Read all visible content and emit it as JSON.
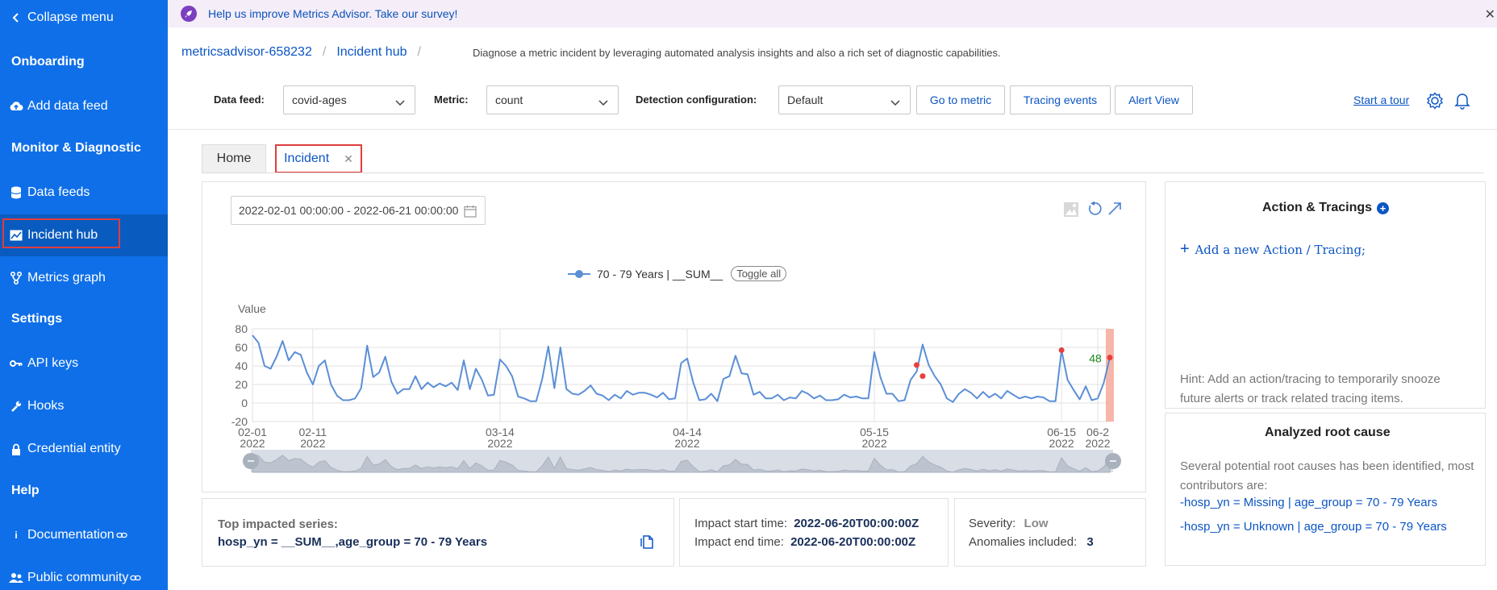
{
  "sidebar": {
    "collapse_label": "Collapse menu",
    "sections": {
      "onboarding": "Onboarding",
      "monitor": "Monitor & Diagnostic",
      "settings": "Settings",
      "help": "Help"
    },
    "items": {
      "add_data_feed": "Add data feed",
      "data_feeds": "Data feeds",
      "incident_hub": "Incident hub",
      "metrics_graph": "Metrics graph",
      "api_keys": "API keys",
      "hooks": "Hooks",
      "credential_entity": "Credential entity",
      "documentation": "Documentation",
      "public_community": "Public community"
    },
    "accent": "#0f6fe8",
    "active_bg": "#0a5bbf"
  },
  "banner": {
    "text": "Help us improve Metrics Advisor. Take our survey!"
  },
  "breadcrumb": {
    "resource": "metricsadvisor-658232",
    "page": "Incident hub",
    "description": "Diagnose a metric incident by leveraging automated analysis insights and also a rich set of diagnostic capabilities."
  },
  "toolbar": {
    "data_feed_label": "Data feed:",
    "data_feed_value": "covid-ages",
    "metric_label": "Metric:",
    "metric_value": "count",
    "detection_label": "Detection configuration:",
    "detection_value": "Default",
    "go_to_metric": "Go to metric",
    "tracing_events": "Tracing events",
    "alert_view": "Alert View",
    "start_tour": "Start a tour"
  },
  "tabs": {
    "home": "Home",
    "incident": "Incident"
  },
  "chart_panel": {
    "date_range": "2022-02-01 00:00:00 - 2022-06-21 00:00:00",
    "legend_series": "70 - 79 Years | __SUM__",
    "toggle_all": "Toggle all"
  },
  "chart_data": {
    "type": "line",
    "ylabel": "Value",
    "ylim": [
      -20,
      80
    ],
    "y_ticks": [
      "80",
      "60",
      "40",
      "20",
      "0",
      "-20"
    ],
    "x_ticks": [
      {
        "date": "02-01",
        "year": "2022",
        "day": 0
      },
      {
        "date": "02-11",
        "year": "2022",
        "day": 10
      },
      {
        "date": "03-14",
        "year": "2022",
        "day": 41
      },
      {
        "date": "04-14",
        "year": "2022",
        "day": 72
      },
      {
        "date": "05-15",
        "year": "2022",
        "day": 103
      },
      {
        "date": "06-15",
        "year": "2022",
        "day": 134
      },
      {
        "date": "06-2",
        "year": "2022",
        "day": 140
      }
    ],
    "series": [
      {
        "name": "70 - 79 Years | __SUM__",
        "color": "#5b8fd6",
        "values": [
          73,
          65,
          40,
          37,
          50,
          67,
          46,
          55,
          52,
          33,
          20,
          40,
          46,
          20,
          8,
          3,
          3,
          5,
          16,
          62,
          28,
          33,
          50,
          23,
          10,
          15,
          15,
          29,
          15,
          22,
          17,
          21,
          18,
          22,
          14,
          46,
          15,
          37,
          25,
          8,
          9,
          47,
          40,
          29,
          7,
          5,
          2,
          2,
          26,
          61,
          16,
          60,
          15,
          10,
          9,
          13,
          19,
          10,
          8,
          3,
          9,
          5,
          13,
          9,
          11,
          11,
          9,
          6,
          11,
          4,
          5,
          43,
          48,
          22,
          3,
          4,
          10,
          2,
          26,
          29,
          51,
          32,
          31,
          9,
          12,
          5,
          5,
          9,
          3,
          6,
          5,
          13,
          10,
          5,
          8,
          3,
          3,
          4,
          9,
          6,
          7,
          5,
          5,
          55,
          28,
          10,
          10,
          2,
          3,
          25,
          34,
          63,
          41,
          29,
          20,
          5,
          1,
          10,
          15,
          11,
          5,
          12,
          6,
          10,
          5,
          13,
          9,
          5,
          7,
          5,
          7,
          6,
          2,
          2,
          57,
          25,
          14,
          4,
          18,
          3,
          5,
          22,
          49
        ],
        "anomalies": [
          {
            "day": 110,
            "value": 41
          },
          {
            "day": 111,
            "value": 29
          },
          {
            "day": 134,
            "value": 57
          },
          {
            "day": 142,
            "value": 49
          }
        ],
        "anomaly_label": "48",
        "anomaly_color": "#e84040"
      }
    ]
  },
  "info_cards": {
    "top_impacted_label": "Top impacted series:",
    "top_impacted_value": "hosp_yn = __SUM__,age_group = 70 - 79 Years",
    "impact_start_label": "Impact start time:",
    "impact_start_value": "2022-06-20T00:00:00Z",
    "impact_end_label": "Impact end time:",
    "impact_end_value": "2022-06-20T00:00:00Z",
    "severity_label": "Severity:",
    "severity_value": "Low",
    "anomalies_label": "Anomalies included:",
    "anomalies_value": "3"
  },
  "actions": {
    "title": "Action & Tracings",
    "add_link": "Add a new Action / Tracing;",
    "hint": "Hint: Add an action/tracing to temporarily snooze future alerts or track related tracing items."
  },
  "root_cause": {
    "title": "Analyzed root cause",
    "intro": "Several potential root causes has been identified, most contributors are:",
    "items": [
      "-hosp_yn = Missing | age_group = 70 - 79 Years",
      "-hosp_yn = Unknown | age_group = 70 - 79 Years"
    ]
  }
}
